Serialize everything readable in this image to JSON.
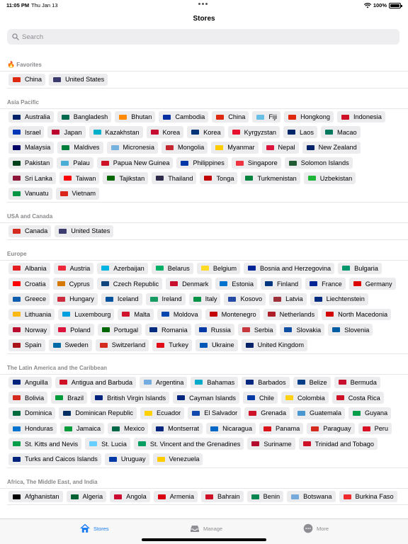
{
  "status": {
    "time": "11:05 PM",
    "date": "Thu Jan 13",
    "battery": "100%"
  },
  "nav": {
    "title": "Stores"
  },
  "search": {
    "placeholder": "Search"
  },
  "sections": [
    {
      "title": "Favorites",
      "icon": "fire-icon",
      "items": [
        {
          "label": "China",
          "color": "#de2910"
        },
        {
          "label": "United States",
          "color": "#3c3b6e"
        }
      ]
    },
    {
      "title": "Asia Pacific",
      "items": [
        {
          "label": "Australia",
          "color": "#012169"
        },
        {
          "label": "Bangladesh",
          "color": "#006a4e"
        },
        {
          "label": "Bhutan",
          "color": "#ff8a00"
        },
        {
          "label": "Cambodia",
          "color": "#032ea1"
        },
        {
          "label": "China",
          "color": "#de2910"
        },
        {
          "label": "Fiji",
          "color": "#68bfe5"
        },
        {
          "label": "Hongkong",
          "color": "#de2910"
        },
        {
          "label": "Indonesia",
          "color": "#ce1126"
        },
        {
          "label": "Israel",
          "color": "#0038b8"
        },
        {
          "label": "Japan",
          "color": "#bc002d"
        },
        {
          "label": "Kazakhstan",
          "color": "#00afca"
        },
        {
          "label": "Korea",
          "color": "#c60c30"
        },
        {
          "label": "Korea",
          "color": "#003478"
        },
        {
          "label": "Kyrgyzstan",
          "color": "#e8112d"
        },
        {
          "label": "Laos",
          "color": "#002868"
        },
        {
          "label": "Macao",
          "color": "#00785e"
        },
        {
          "label": "Malaysia",
          "color": "#010066"
        },
        {
          "label": "Maldives",
          "color": "#007e3a"
        },
        {
          "label": "Micronesia",
          "color": "#75b2dd"
        },
        {
          "label": "Mongolia",
          "color": "#c4272f"
        },
        {
          "label": "Myanmar",
          "color": "#fecb00"
        },
        {
          "label": "Nepal",
          "color": "#dc143c"
        },
        {
          "label": "New Zealand",
          "color": "#012169"
        },
        {
          "label": "Pakistan",
          "color": "#01411c"
        },
        {
          "label": "Palau",
          "color": "#4aadd6"
        },
        {
          "label": "Papua New Guinea",
          "color": "#ce1126"
        },
        {
          "label": "Philippines",
          "color": "#0038a8"
        },
        {
          "label": "Singapore",
          "color": "#ef3340"
        },
        {
          "label": "Solomon Islands",
          "color": "#215b33"
        },
        {
          "label": "Sri Lanka",
          "color": "#8d153a"
        },
        {
          "label": "Taiwan",
          "color": "#fe0000"
        },
        {
          "label": "Tajikstan",
          "color": "#006600"
        },
        {
          "label": "Thailand",
          "color": "#2d2a4a"
        },
        {
          "label": "Tonga",
          "color": "#c10000"
        },
        {
          "label": "Turkmenistan",
          "color": "#00843d"
        },
        {
          "label": "Uzbekistan",
          "color": "#1eb53a"
        },
        {
          "label": "Vanuatu",
          "color": "#009543"
        },
        {
          "label": "Vietnam",
          "color": "#da251d"
        }
      ]
    },
    {
      "title": "USA and Canada",
      "items": [
        {
          "label": "Canada",
          "color": "#d52b1e"
        },
        {
          "label": "United States",
          "color": "#3c3b6e"
        }
      ]
    },
    {
      "title": "Europe",
      "items": [
        {
          "label": "Albania",
          "color": "#e41e20"
        },
        {
          "label": "Austria",
          "color": "#ed2939"
        },
        {
          "label": "Azerbaijan",
          "color": "#00b5e2"
        },
        {
          "label": "Belarus",
          "color": "#00af66"
        },
        {
          "label": "Belgium",
          "color": "#fdda24"
        },
        {
          "label": "Bosnia and Herzegovina",
          "color": "#002395"
        },
        {
          "label": "Bulgaria",
          "color": "#00966e"
        },
        {
          "label": "Croatia",
          "color": "#ff0000"
        },
        {
          "label": "Cyprus",
          "color": "#d57800"
        },
        {
          "label": "Czech Republic",
          "color": "#11457e"
        },
        {
          "label": "Denmark",
          "color": "#c8102e"
        },
        {
          "label": "Estonia",
          "color": "#0072ce"
        },
        {
          "label": "Finland",
          "color": "#003580"
        },
        {
          "label": "France",
          "color": "#002395"
        },
        {
          "label": "Germany",
          "color": "#dd0000"
        },
        {
          "label": "Greece",
          "color": "#0d5eaf"
        },
        {
          "label": "Hungary",
          "color": "#cd2a3e"
        },
        {
          "label": "Iceland",
          "color": "#02529c"
        },
        {
          "label": "Ireland",
          "color": "#169b62"
        },
        {
          "label": "Italy",
          "color": "#009246"
        },
        {
          "label": "Kosovo",
          "color": "#244aa5"
        },
        {
          "label": "Latvia",
          "color": "#9e3039"
        },
        {
          "label": "Liechtenstein",
          "color": "#002b7f"
        },
        {
          "label": "Lithuania",
          "color": "#fdb913"
        },
        {
          "label": "Luxembourg",
          "color": "#00a1de"
        },
        {
          "label": "Malta",
          "color": "#cf142b"
        },
        {
          "label": "Moldova",
          "color": "#0046ae"
        },
        {
          "label": "Montenegro",
          "color": "#c40308"
        },
        {
          "label": "Netherlands",
          "color": "#ae1c28"
        },
        {
          "label": "North Macedonia",
          "color": "#d20000"
        },
        {
          "label": "Norway",
          "color": "#ba0c2f"
        },
        {
          "label": "Poland",
          "color": "#dc143c"
        },
        {
          "label": "Portugal",
          "color": "#006600"
        },
        {
          "label": "Romania",
          "color": "#002b7f"
        },
        {
          "label": "Russia",
          "color": "#0039a6"
        },
        {
          "label": "Serbia",
          "color": "#c6363c"
        },
        {
          "label": "Slovakia",
          "color": "#0b4ea2"
        },
        {
          "label": "Slovenia",
          "color": "#005da4"
        },
        {
          "label": "Spain",
          "color": "#aa151b"
        },
        {
          "label": "Sweden",
          "color": "#006aa7"
        },
        {
          "label": "Switzerland",
          "color": "#d52b1e"
        },
        {
          "label": "Turkey",
          "color": "#e30a17"
        },
        {
          "label": "Ukraine",
          "color": "#0057b7"
        },
        {
          "label": "United Kingdom",
          "color": "#012169"
        }
      ]
    },
    {
      "title": "The Latin America and the Caribbean",
      "items": [
        {
          "label": "Anguilla",
          "color": "#00247d"
        },
        {
          "label": "Antigua and Barbuda",
          "color": "#ce1126"
        },
        {
          "label": "Argentina",
          "color": "#74acdf"
        },
        {
          "label": "Bahamas",
          "color": "#00abc9"
        },
        {
          "label": "Barbados",
          "color": "#00267f"
        },
        {
          "label": "Belize",
          "color": "#003f87"
        },
        {
          "label": "Bermuda",
          "color": "#c8102e"
        },
        {
          "label": "Bolivia",
          "color": "#d52b1e"
        },
        {
          "label": "Brazil",
          "color": "#009c3b"
        },
        {
          "label": "British Virgin Islands",
          "color": "#00247d"
        },
        {
          "label": "Cayman Islands",
          "color": "#00247d"
        },
        {
          "label": "Chile",
          "color": "#0039a6"
        },
        {
          "label": "Colombia",
          "color": "#fcd116"
        },
        {
          "label": "Costa Rica",
          "color": "#ce1126"
        },
        {
          "label": "Dominica",
          "color": "#006b3f"
        },
        {
          "label": "Dominican Republic",
          "color": "#002d62"
        },
        {
          "label": "Ecuador",
          "color": "#ffd100"
        },
        {
          "label": "El Salvador",
          "color": "#0f47af"
        },
        {
          "label": "Grenada",
          "color": "#ce1126"
        },
        {
          "label": "Guatemala",
          "color": "#4997d0"
        },
        {
          "label": "Guyana",
          "color": "#009e49"
        },
        {
          "label": "Honduras",
          "color": "#0073cf"
        },
        {
          "label": "Jamaica",
          "color": "#009b3a"
        },
        {
          "label": "Mexico",
          "color": "#006847"
        },
        {
          "label": "Montserrat",
          "color": "#00247d"
        },
        {
          "label": "Nicaragua",
          "color": "#0067c6"
        },
        {
          "label": "Panama",
          "color": "#da121a"
        },
        {
          "label": "Paraguay",
          "color": "#d52b1e"
        },
        {
          "label": "Peru",
          "color": "#d91023"
        },
        {
          "label": "St. Kitts and Nevis",
          "color": "#009e49"
        },
        {
          "label": "St. Lucia",
          "color": "#65cfff"
        },
        {
          "label": "St. Vincent and the Grenadines",
          "color": "#009e60"
        },
        {
          "label": "Suriname",
          "color": "#b40a2d"
        },
        {
          "label": "Trinidad and Tobago",
          "color": "#ce1126"
        },
        {
          "label": "Turks and Caicos Islands",
          "color": "#00247d"
        },
        {
          "label": "Uruguay",
          "color": "#0038a8"
        },
        {
          "label": "Venezuela",
          "color": "#ffcc00"
        }
      ]
    },
    {
      "title": "Africa, The Middle East, and India",
      "items": [
        {
          "label": "Afghanistan",
          "color": "#000000"
        },
        {
          "label": "Algeria",
          "color": "#006233"
        },
        {
          "label": "Angola",
          "color": "#cc092f"
        },
        {
          "label": "Armenia",
          "color": "#d90012"
        },
        {
          "label": "Bahrain",
          "color": "#ce1126"
        },
        {
          "label": "Benin",
          "color": "#008751"
        },
        {
          "label": "Botswana",
          "color": "#75aadb"
        },
        {
          "label": "Burkina Faso",
          "color": "#ef2b2d"
        }
      ]
    }
  ],
  "tabs": [
    {
      "label": "Stores",
      "icon": "house-icon",
      "active": true
    },
    {
      "label": "Manage",
      "icon": "tray-icon",
      "active": false
    },
    {
      "label": "More",
      "icon": "ellipsis-circle-icon",
      "active": false
    }
  ],
  "colors": {
    "accent": "#1a7cf0",
    "chip_bg": "#ececee",
    "section_text": "#8a8a8e"
  }
}
